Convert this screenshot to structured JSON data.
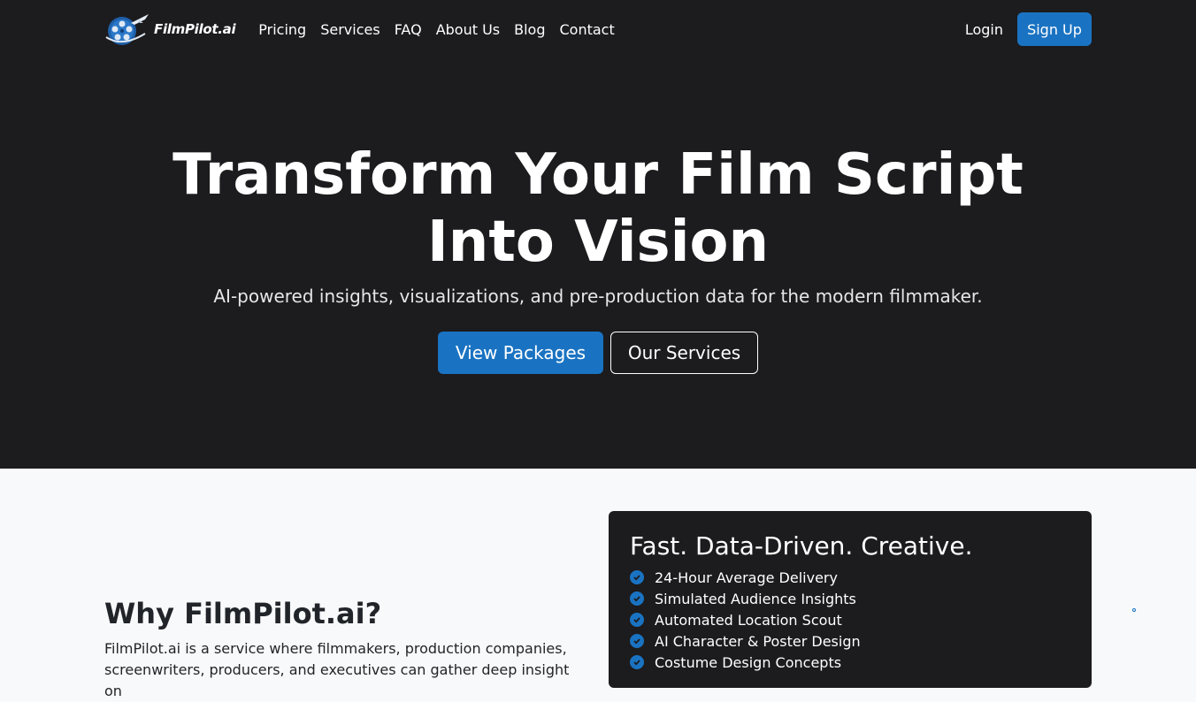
{
  "brand": {
    "name": "FilmPilot",
    "suffix": ".ai"
  },
  "nav": {
    "links": [
      "Pricing",
      "Services",
      "FAQ",
      "About Us",
      "Blog",
      "Contact"
    ],
    "login": "Login",
    "signup": "Sign Up"
  },
  "hero": {
    "title": "Transform Your Film Script Into Vision",
    "subtitle": "AI-powered insights, visualizations, and pre-production data for the modern filmmaker.",
    "primary_button": "View Packages",
    "secondary_button": "Our Services"
  },
  "why": {
    "heading": "Why FilmPilot.ai?",
    "body": "FilmPilot.ai is a service where filmmakers, production companies, screenwriters, producers, and executives can gather deep insight on"
  },
  "features_card": {
    "title": "Fast. Data-Driven. Creative.",
    "items": [
      "24-Hour Average Delivery",
      "Simulated Audience Insights",
      "Automated Location Scout",
      "AI Character & Poster Design",
      "Costume Design Concepts"
    ]
  },
  "colors": {
    "dark_bg": "#1c1b1d",
    "accent": "#1a73c2",
    "light_bg": "#f8f9fa"
  }
}
